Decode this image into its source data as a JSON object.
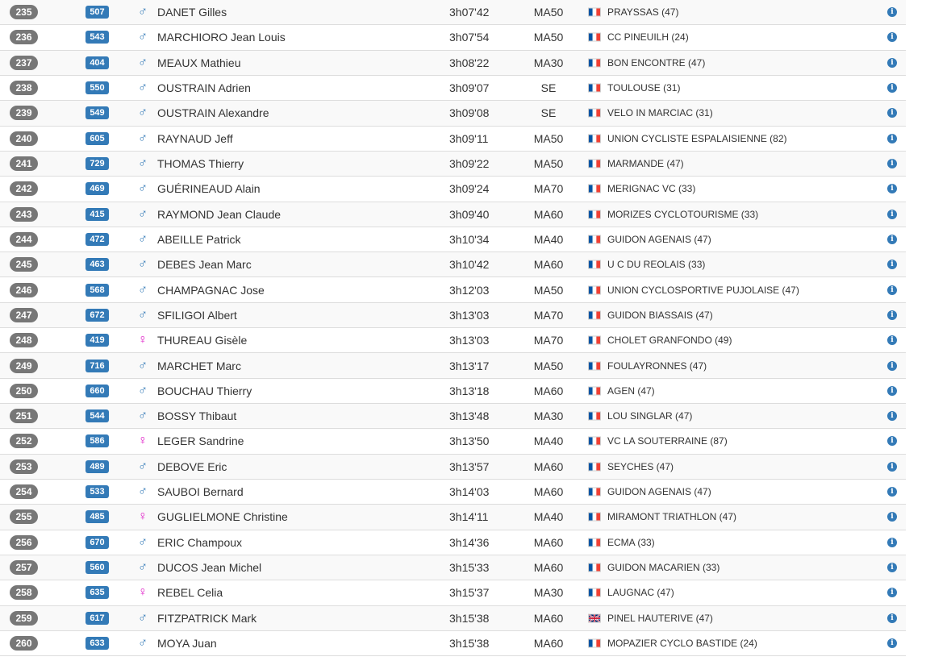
{
  "rows": [
    {
      "rank": "235",
      "bib": "507",
      "gender": "male",
      "name": "DANET Gilles",
      "time": "3h07'42",
      "category": "MA50",
      "flag": "fr",
      "club": "PRAYSSAS (47)"
    },
    {
      "rank": "236",
      "bib": "543",
      "gender": "male",
      "name": "MARCHIORO Jean Louis",
      "time": "3h07'54",
      "category": "MA50",
      "flag": "fr",
      "club": "CC PINEUILH (24)"
    },
    {
      "rank": "237",
      "bib": "404",
      "gender": "male",
      "name": "MEAUX Mathieu",
      "time": "3h08'22",
      "category": "MA30",
      "flag": "fr",
      "club": "BON ENCONTRE (47)"
    },
    {
      "rank": "238",
      "bib": "550",
      "gender": "male",
      "name": "OUSTRAIN Adrien",
      "time": "3h09'07",
      "category": "SE",
      "flag": "fr",
      "club": "TOULOUSE (31)"
    },
    {
      "rank": "239",
      "bib": "549",
      "gender": "male",
      "name": "OUSTRAIN Alexandre",
      "time": "3h09'08",
      "category": "SE",
      "flag": "fr",
      "club": "VELO IN MARCIAC (31)"
    },
    {
      "rank": "240",
      "bib": "605",
      "gender": "male",
      "name": "RAYNAUD Jeff",
      "time": "3h09'11",
      "category": "MA50",
      "flag": "fr",
      "club": "UNION CYCLISTE ESPALAISIENNE (82)"
    },
    {
      "rank": "241",
      "bib": "729",
      "gender": "male",
      "name": "THOMAS Thierry",
      "time": "3h09'22",
      "category": "MA50",
      "flag": "fr",
      "club": "MARMANDE (47)"
    },
    {
      "rank": "242",
      "bib": "469",
      "gender": "male",
      "name": "GUÉRINEAUD Alain",
      "time": "3h09'24",
      "category": "MA70",
      "flag": "fr",
      "club": "MERIGNAC VC (33)"
    },
    {
      "rank": "243",
      "bib": "415",
      "gender": "male",
      "name": "RAYMOND Jean Claude",
      "time": "3h09'40",
      "category": "MA60",
      "flag": "fr",
      "club": "MORIZES CYCLOTOURISME (33)"
    },
    {
      "rank": "244",
      "bib": "472",
      "gender": "male",
      "name": "ABEILLE Patrick",
      "time": "3h10'34",
      "category": "MA40",
      "flag": "fr",
      "club": "GUIDON AGENAIS (47)"
    },
    {
      "rank": "245",
      "bib": "463",
      "gender": "male",
      "name": "DEBES Jean Marc",
      "time": "3h10'42",
      "category": "MA60",
      "flag": "fr",
      "club": "U C DU REOLAIS (33)"
    },
    {
      "rank": "246",
      "bib": "568",
      "gender": "male",
      "name": "CHAMPAGNAC Jose",
      "time": "3h12'03",
      "category": "MA50",
      "flag": "fr",
      "club": "UNION CYCLOSPORTIVE PUJOLAISE (47)"
    },
    {
      "rank": "247",
      "bib": "672",
      "gender": "male",
      "name": "SFILIGOI Albert",
      "time": "3h13'03",
      "category": "MA70",
      "flag": "fr",
      "club": "GUIDON BIASSAIS (47)"
    },
    {
      "rank": "248",
      "bib": "419",
      "gender": "female",
      "name": "THUREAU Gisèle",
      "time": "3h13'03",
      "category": "MA70",
      "flag": "fr",
      "club": "CHOLET GRANFONDO (49)"
    },
    {
      "rank": "249",
      "bib": "716",
      "gender": "male",
      "name": "MARCHET Marc",
      "time": "3h13'17",
      "category": "MA50",
      "flag": "fr",
      "club": "FOULAYRONNES (47)"
    },
    {
      "rank": "250",
      "bib": "660",
      "gender": "male",
      "name": "BOUCHAU Thierry",
      "time": "3h13'18",
      "category": "MA60",
      "flag": "fr",
      "club": "AGEN (47)"
    },
    {
      "rank": "251",
      "bib": "544",
      "gender": "male",
      "name": "BOSSY Thibaut",
      "time": "3h13'48",
      "category": "MA30",
      "flag": "fr",
      "club": "LOU SINGLAR (47)"
    },
    {
      "rank": "252",
      "bib": "586",
      "gender": "female",
      "name": "LEGER Sandrine",
      "time": "3h13'50",
      "category": "MA40",
      "flag": "fr",
      "club": "VC LA SOUTERRAINE (87)"
    },
    {
      "rank": "253",
      "bib": "489",
      "gender": "male",
      "name": "DEBOVE Eric",
      "time": "3h13'57",
      "category": "MA60",
      "flag": "fr",
      "club": "SEYCHES (47)"
    },
    {
      "rank": "254",
      "bib": "533",
      "gender": "male",
      "name": "SAUBOI Bernard",
      "time": "3h14'03",
      "category": "MA60",
      "flag": "fr",
      "club": "GUIDON AGENAIS (47)"
    },
    {
      "rank": "255",
      "bib": "485",
      "gender": "female",
      "name": "GUGLIELMONE Christine",
      "time": "3h14'11",
      "category": "MA40",
      "flag": "fr",
      "club": "MIRAMONT TRIATHLON (47)"
    },
    {
      "rank": "256",
      "bib": "670",
      "gender": "male",
      "name": "ERIC Champoux",
      "time": "3h14'36",
      "category": "MA60",
      "flag": "fr",
      "club": "ECMA (33)"
    },
    {
      "rank": "257",
      "bib": "560",
      "gender": "male",
      "name": "DUCOS Jean Michel",
      "time": "3h15'33",
      "category": "MA60",
      "flag": "fr",
      "club": "GUIDON MACARIEN (33)"
    },
    {
      "rank": "258",
      "bib": "635",
      "gender": "female",
      "name": "REBEL Celia",
      "time": "3h15'37",
      "category": "MA30",
      "flag": "fr",
      "club": "LAUGNAC (47)"
    },
    {
      "rank": "259",
      "bib": "617",
      "gender": "male",
      "name": "FITZPATRICK Mark",
      "time": "3h15'38",
      "category": "MA60",
      "flag": "gb",
      "club": "PINEL HAUTERIVE (47)"
    },
    {
      "rank": "260",
      "bib": "633",
      "gender": "male",
      "name": "MOYA Juan",
      "time": "3h15'38",
      "category": "MA60",
      "flag": "fr",
      "club": "MOPAZIER CYCLO BASTIDE (24)"
    }
  ]
}
